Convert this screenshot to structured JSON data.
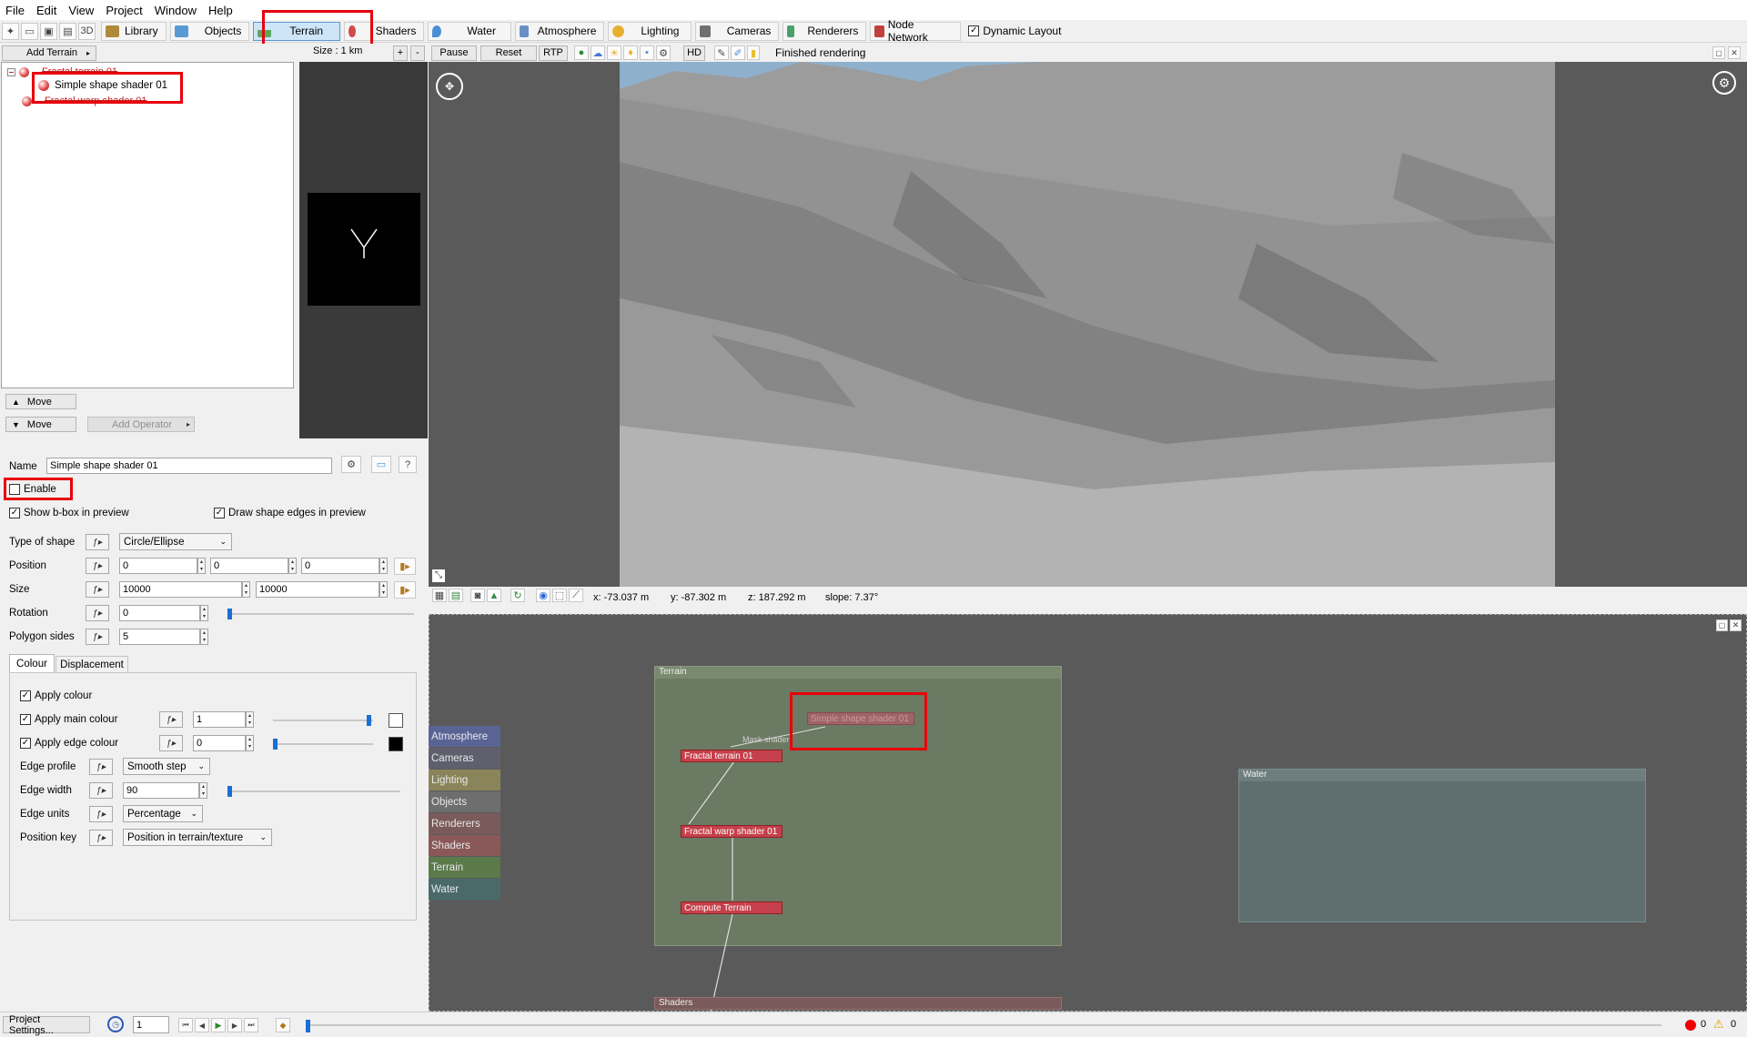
{
  "menu": [
    "File",
    "Edit",
    "View",
    "Project",
    "Window",
    "Help"
  ],
  "toolbar": {
    "tabs": [
      {
        "label": "Library",
        "icon": "library-icon",
        "color": "#b08a3a"
      },
      {
        "label": "Objects",
        "icon": "cube-icon",
        "color": "#5a9ad4"
      },
      {
        "label": "Terrain",
        "icon": "terrain-icon",
        "color": "#5aa85a",
        "active": true
      },
      {
        "label": "Shaders",
        "icon": "shader-ball-icon",
        "color": "#d24a4a"
      },
      {
        "label": "Water",
        "icon": "water-drop-icon",
        "color": "#4a8fd4"
      },
      {
        "label": "Atmosphere",
        "icon": "atmosphere-icon",
        "color": "#6a8fc4"
      },
      {
        "label": "Lighting",
        "icon": "sun-icon",
        "color": "#e8b030"
      },
      {
        "label": "Cameras",
        "icon": "camera-icon",
        "color": "#707070"
      },
      {
        "label": "Renderers",
        "icon": "renderer-icon",
        "color": "#4aa06a"
      },
      {
        "label": "Node Network",
        "icon": "node-network-icon",
        "color": "#c04040"
      }
    ],
    "dynamic_layout": "Dynamic Layout",
    "dynamic_layout_checked": true
  },
  "toolbar2": {
    "add_terrain": "Add Terrain",
    "size_label": "Size : 1 km",
    "plus": "+",
    "minus": "-",
    "pause": "Pause",
    "reset": "Reset",
    "rtp": "RTP",
    "hd": "HD",
    "status": "Finished rendering"
  },
  "tree": {
    "items": [
      "Fractal terrain 01",
      "Simple shape shader 01",
      "Fractal warp shader 01"
    ]
  },
  "tree_controls": {
    "move_up": "Move",
    "move_down": "Move",
    "add_operator": "Add Operator"
  },
  "properties": {
    "name_label": "Name",
    "name_value": "Simple shape shader 01",
    "enable_label": "Enable",
    "enable_checked": false,
    "show_bbox": "Show b-box in preview",
    "draw_edges": "Draw shape edges in preview",
    "type_of_shape_label": "Type of shape",
    "type_of_shape_value": "Circle/Ellipse",
    "position_label": "Position",
    "position": [
      "0",
      "0",
      "0"
    ],
    "size_label": "Size",
    "size": [
      "10000",
      "10000"
    ],
    "rotation_label": "Rotation",
    "rotation": "0",
    "polygon_sides_label": "Polygon sides",
    "polygon_sides": "5",
    "tabs": [
      "Colour",
      "Displacement"
    ],
    "apply_colour": "Apply colour",
    "apply_main_colour": "Apply main colour",
    "main_colour_value": "1",
    "apply_edge_colour": "Apply edge colour",
    "edge_colour_value": "0",
    "edge_profile_label": "Edge profile",
    "edge_profile_value": "Smooth step",
    "edge_width_label": "Edge width",
    "edge_width_value": "90",
    "edge_units_label": "Edge units",
    "edge_units_value": "Percentage",
    "position_key_label": "Position key",
    "position_key_value": "Position in terrain/texture"
  },
  "viewport_status": {
    "x": "x: -73.037 m",
    "y": "y: -87.302 m",
    "z": "z: 187.292 m",
    "slope": "slope: 7.37°"
  },
  "node_network": {
    "categories": [
      {
        "label": "Atmosphere",
        "color": "#5a6494"
      },
      {
        "label": "Cameras",
        "color": "#5f5f6e"
      },
      {
        "label": "Lighting",
        "color": "#8a845a"
      },
      {
        "label": "Objects",
        "color": "#6e6e6e"
      },
      {
        "label": "Renderers",
        "color": "#7a5a5a"
      },
      {
        "label": "Shaders",
        "color": "#8a5858"
      },
      {
        "label": "Terrain",
        "color": "#5a7a4a"
      },
      {
        "label": "Water",
        "color": "#4a6a6a"
      }
    ],
    "terrain_group": "Terrain",
    "water_group": "Water",
    "shaders_group": "Shaders",
    "nodes": {
      "simple_shape": "Simple shape shader 01",
      "mask_shader": "Mask shader",
      "fractal_terrain": "Fractal terrain 01",
      "fractal_warp": "Fractal warp shader 01",
      "compute_terrain": "Compute Terrain"
    }
  },
  "bottom": {
    "project_settings": "Project Settings...",
    "frame": "1",
    "errors": "0",
    "warnings": "0"
  }
}
